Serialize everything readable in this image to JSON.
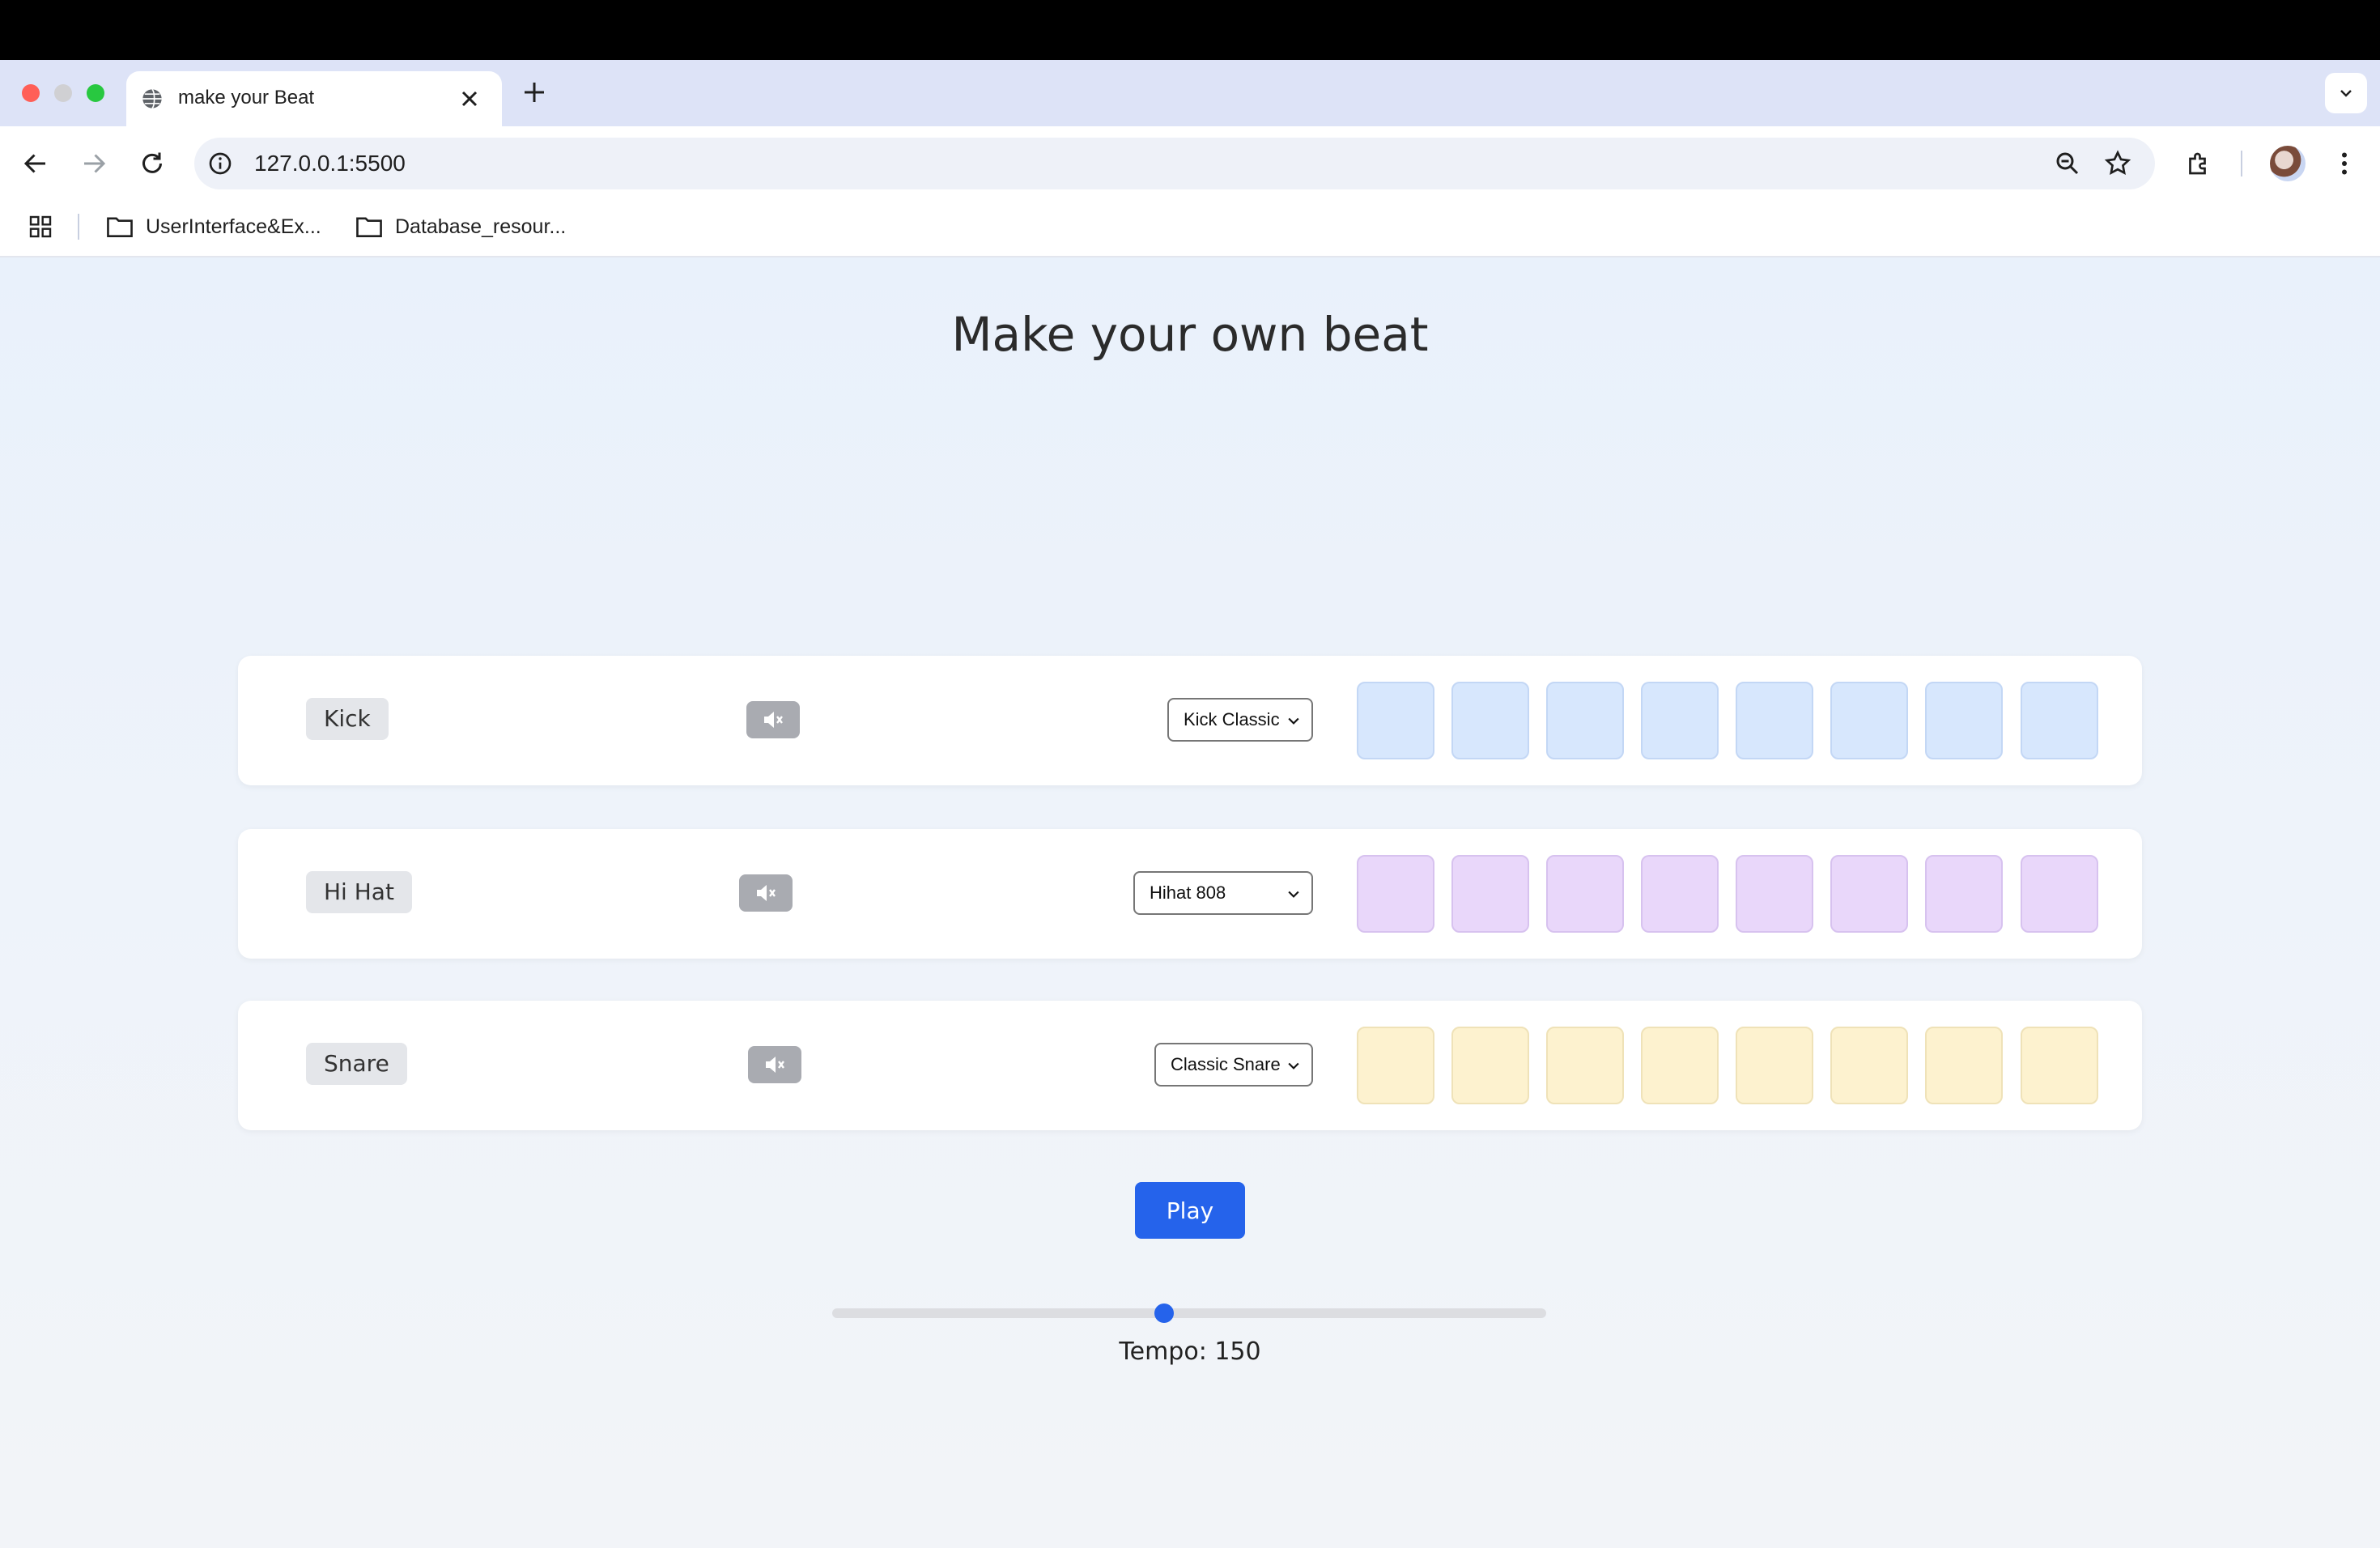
{
  "browser": {
    "tab_title": "make your Beat",
    "url": "127.0.0.1:5500",
    "bookmarks": [
      {
        "label": "UserInterface&Ex..."
      },
      {
        "label": "Database_resour..."
      }
    ]
  },
  "page": {
    "title": "Make your own beat",
    "tracks": [
      {
        "label": "Kick",
        "sound": "Kick Classic",
        "mute_icon": "speaker-muted-icon",
        "pad_color": "#d7e7fd",
        "pads": 8
      },
      {
        "label": "Hi Hat",
        "sound": "Hihat 808",
        "mute_icon": "speaker-muted-icon",
        "pad_color": "#e9d7fa",
        "pads": 8
      },
      {
        "label": "Snare",
        "sound": "Classic Snare",
        "mute_icon": "speaker-muted-icon",
        "pad_color": "#fdf2cf",
        "pads": 8
      }
    ],
    "play_label": "Play",
    "tempo": {
      "label_text": "Tempo: 150",
      "value": 150,
      "slider_fraction": 0.465
    },
    "accent_color": "#2563eb"
  }
}
